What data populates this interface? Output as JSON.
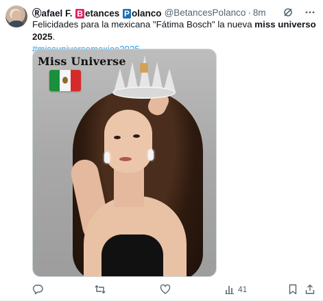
{
  "author": {
    "name_prefix": "Ⓡafael F.",
    "badge_b": "B",
    "name_b_rest": "etances",
    "badge_p": "P",
    "name_p_rest": "olanco",
    "handle": "@BetancesPolanco",
    "separator": "·",
    "time": "8m"
  },
  "tweet": {
    "text_before": "Felicidades para la mexicana \"Fátima Bosch\" la nueva ",
    "text_bold": "miss universo 2025",
    "text_after": ".",
    "hashtag": "#missuniversemexico2025",
    "hashtag_after": " ."
  },
  "media": {
    "overlay_text": "Miss Universe",
    "flag_icon": "mexico-flag-icon"
  },
  "actions": {
    "reply_count": "",
    "retweet_count": "",
    "like_count": "",
    "views_count": "41"
  },
  "colors": {
    "accent": "#1d9bf0",
    "muted": "#536471",
    "text": "#0f1419",
    "badge_red": "#e0245e",
    "badge_blue": "#1f6fb5"
  },
  "icons": {
    "header_left": "grok-icon",
    "header_right": "more-icon",
    "reply": "reply-icon",
    "retweet": "retweet-icon",
    "like": "heart-icon",
    "views": "views-icon",
    "bookmark": "bookmark-icon",
    "share": "share-icon"
  }
}
